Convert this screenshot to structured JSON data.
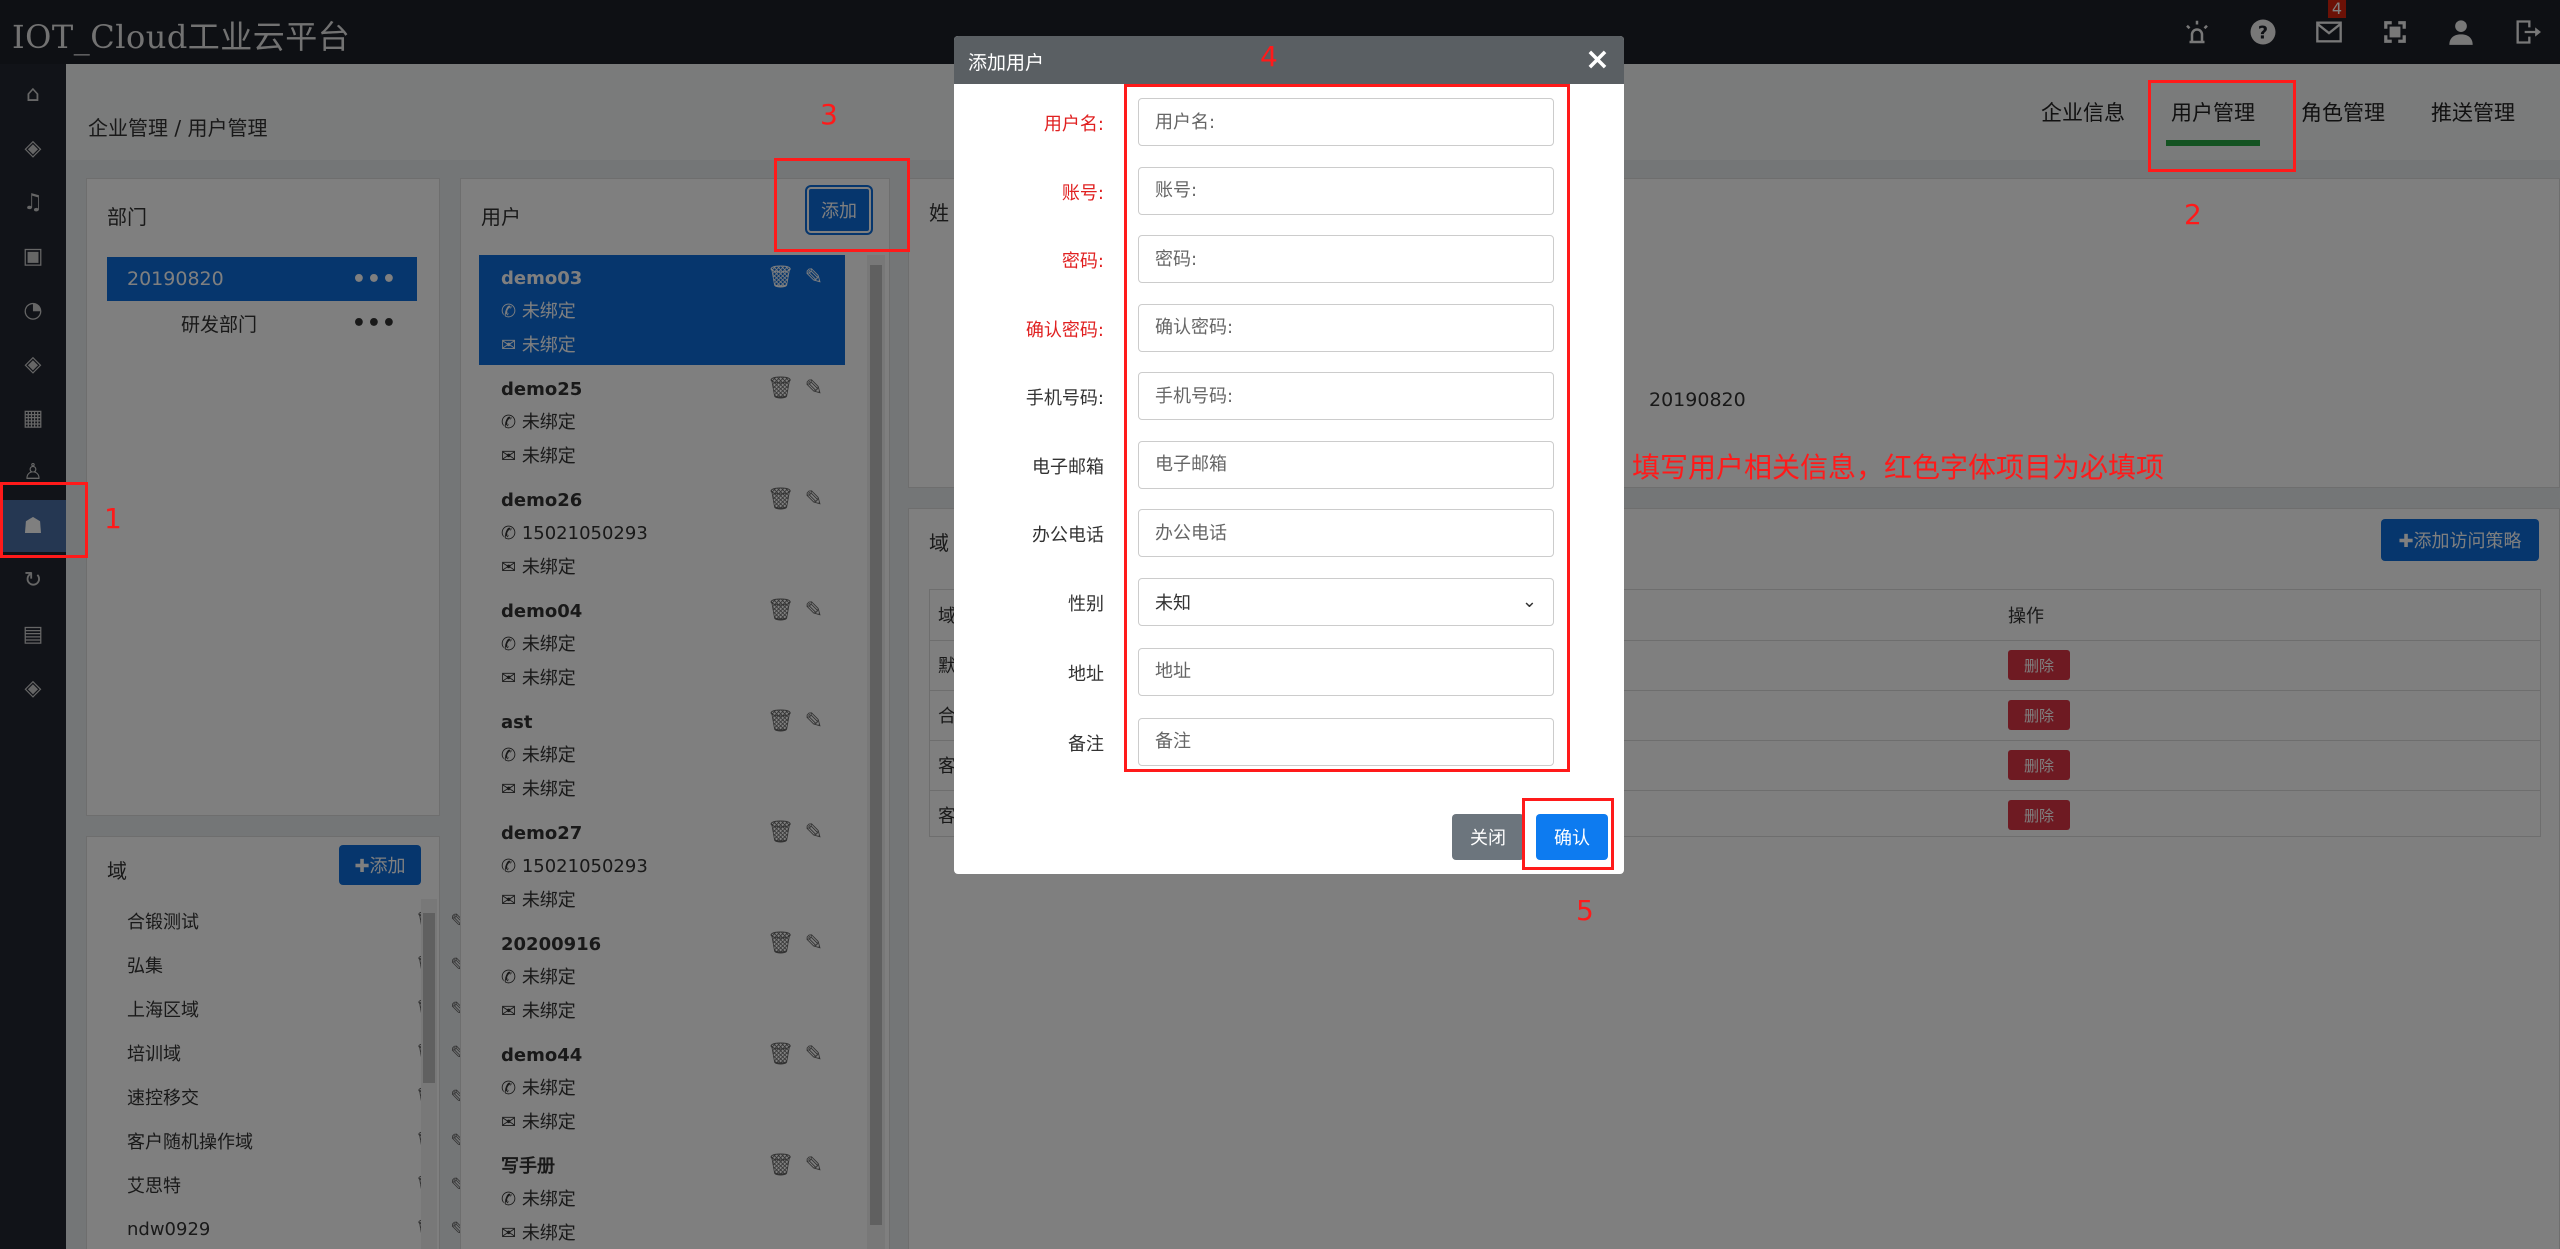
{
  "app": {
    "title": "IOT_Cloud工业云平台"
  },
  "topbar": {
    "icons": [
      "alarm-icon",
      "help-icon",
      "mail-icon",
      "fullscreen-icon",
      "user-icon",
      "logout-icon"
    ],
    "mail_badge": "4"
  },
  "breadcrumb": "企业管理 / 用户管理",
  "tabs": [
    {
      "label": "企业信息"
    },
    {
      "label": "用户管理",
      "active": true
    },
    {
      "label": "角色管理"
    },
    {
      "label": "推送管理"
    }
  ],
  "dept_panel": {
    "title": "部门",
    "items": [
      {
        "label": "20190820",
        "selected": true
      },
      {
        "label": "研发部门"
      }
    ]
  },
  "domain_panel": {
    "title": "域",
    "add_label": "✚添加",
    "items": [
      "合锻测试",
      "弘集",
      "上海区域",
      "培训域",
      "速控移交",
      "客户随机操作域",
      "艾思特",
      "ndw0929"
    ]
  },
  "user_panel": {
    "title": "用户",
    "add_label": "添加",
    "users": [
      {
        "name": "demo03",
        "phone": "未绑定",
        "email": "未绑定",
        "selected": true
      },
      {
        "name": "demo25",
        "phone": "未绑定",
        "email": "未绑定"
      },
      {
        "name": "demo26",
        "phone": "15021050293",
        "email": "未绑定"
      },
      {
        "name": "demo04",
        "phone": "未绑定",
        "email": "未绑定"
      },
      {
        "name": "ast",
        "phone": "未绑定",
        "email": "未绑定"
      },
      {
        "name": "demo27",
        "phone": "15021050293",
        "email": "未绑定"
      },
      {
        "name": "20200916",
        "phone": "未绑定",
        "email": "未绑定"
      },
      {
        "name": "demo44",
        "phone": "未绑定",
        "email": "未绑定"
      },
      {
        "name": "写手册",
        "phone": "未绑定",
        "email": "未绑定"
      }
    ]
  },
  "detail": {
    "name_label_partial": "姓",
    "dept_value": "20190820",
    "domain_label_partial": "域",
    "add_policy_label": "✚添加访问策略",
    "col_partial": "域",
    "col_action": "操作",
    "rows": [
      "默",
      "合",
      "客",
      "客"
    ],
    "delete_label": "删除"
  },
  "modal": {
    "title": "添加用户",
    "close_symbol": "×",
    "fields": [
      {
        "label": "用户名:",
        "placeholder": "用户名:",
        "required": true
      },
      {
        "label": "账号:",
        "placeholder": "账号:",
        "required": true
      },
      {
        "label": "密码:",
        "placeholder": "密码:",
        "required": true
      },
      {
        "label": "确认密码:",
        "placeholder": "确认密码:",
        "required": true
      },
      {
        "label": "手机号码:",
        "placeholder": "手机号码:",
        "required": false
      },
      {
        "label": "电子邮箱",
        "placeholder": "电子邮箱",
        "required": false
      },
      {
        "label": "办公电话",
        "placeholder": "办公电话",
        "required": false
      }
    ],
    "gender": {
      "label": "性别",
      "value": "未知"
    },
    "address": {
      "label": "地址",
      "placeholder": "地址"
    },
    "remark": {
      "label": "备注",
      "placeholder": "备注"
    },
    "close_label": "关闭",
    "confirm_label": "确认"
  },
  "annotations": {
    "n1": "1",
    "n2": "2",
    "n3": "3",
    "n4": "4",
    "n5": "5",
    "hint": "填写用户相关信息，红色字体项目为必填项"
  },
  "colors": {
    "primary": "#0d6ddb",
    "annotation": "#ff1a1a",
    "active_tab": "#28a745",
    "danger": "#dc3545"
  }
}
